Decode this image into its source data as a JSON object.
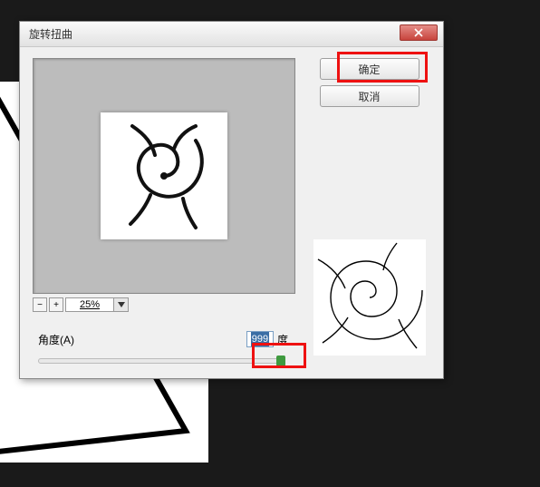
{
  "background": {
    "triangle_visible": true
  },
  "dialog": {
    "title": "旋转扭曲",
    "close_icon": "close",
    "preview": {
      "zoom_minus": "−",
      "zoom_plus": "+",
      "zoom_value": "25%",
      "zoom_dropdown_icon": "chevron-down"
    },
    "angle": {
      "label": "角度(A)",
      "value": "999",
      "unit": "度"
    },
    "buttons": {
      "ok": "确定",
      "cancel": "取消"
    }
  }
}
